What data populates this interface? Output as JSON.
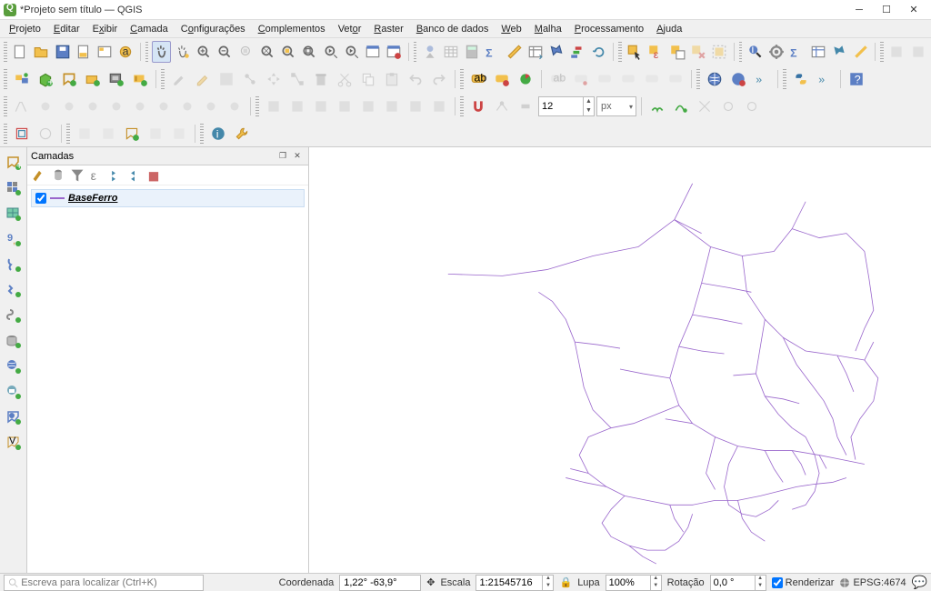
{
  "window": {
    "title": "*Projeto sem título — QGIS"
  },
  "menu": {
    "items": [
      {
        "html": "<u>P</u>rojeto"
      },
      {
        "html": "<u>E</u>ditar"
      },
      {
        "html": "E<u>x</u>ibir"
      },
      {
        "html": "<u>C</u>amada"
      },
      {
        "html": "C<u>o</u>nfigurações"
      },
      {
        "html": "<u>C</u>omplementos"
      },
      {
        "html": "Vet<u>o</u>r"
      },
      {
        "html": "<u>R</u>aster"
      },
      {
        "html": "<u>B</u>anco de dados"
      },
      {
        "html": "<u>W</u>eb"
      },
      {
        "html": "<u>M</u>alha"
      },
      {
        "html": "<u>P</u>rocessamento"
      },
      {
        "html": "<u>A</u>juda"
      }
    ]
  },
  "snap": {
    "value": "12",
    "unit": "px"
  },
  "layers_panel": {
    "title": "Camadas",
    "layer_name": "BaseFerro"
  },
  "statusbar": {
    "locator_placeholder": "Escreva para localizar (Ctrl+K)",
    "coord_label": "Coordenada",
    "coord_value": "1,22° -63,9°",
    "scale_label": "Escala",
    "scale_value": "1:21545716",
    "lupa_label": "Lupa",
    "lupa_value": "100%",
    "rotation_label": "Rotação",
    "rotation_value": "0,0 °",
    "render_label": "Renderizar",
    "crs_label": "EPSG:4674"
  },
  "colors": {
    "map_stroke": "#9966cc"
  }
}
